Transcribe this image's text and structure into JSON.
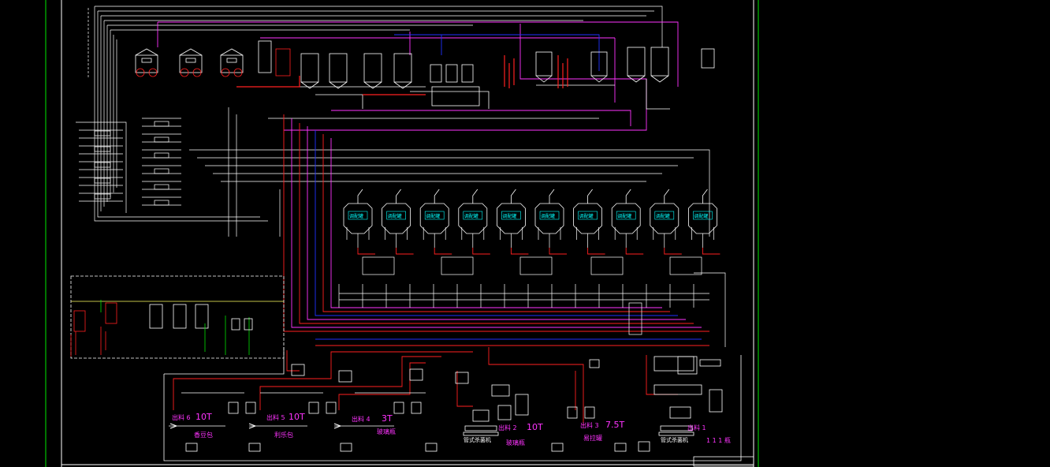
{
  "colors": {
    "background": "#000000",
    "border_green": "#00c000",
    "pipe_white": "#ffffff",
    "pipe_red": "#ff2020",
    "pipe_magenta": "#ff33ff",
    "pipe_blue": "#2030ff",
    "pipe_yellow": "#ffff60",
    "label_cyan": "#00ffff"
  },
  "process_tanks": {
    "count": 10,
    "label": "调配罐"
  },
  "outlets": [
    {
      "name": "出料 6",
      "capacity": "10T",
      "destination": "香豆包"
    },
    {
      "name": "出料 5",
      "capacity": "10T",
      "destination": "利乐包"
    },
    {
      "name": "出料 4",
      "capacity": "3T",
      "destination": "玻璃瓶"
    },
    {
      "name": "出料 2",
      "capacity": "10T",
      "destination": "玻璃瓶"
    },
    {
      "name": "出料 3",
      "capacity": "7.5T",
      "destination": "易拉罐"
    },
    {
      "name": "出料 1",
      "capacity": "",
      "destination": "1 1 1 瓶"
    }
  ],
  "machine_labels": {
    "tubular_sterilizer_1": "管式杀菌机",
    "tubular_sterilizer_2": "管式杀菌机"
  }
}
